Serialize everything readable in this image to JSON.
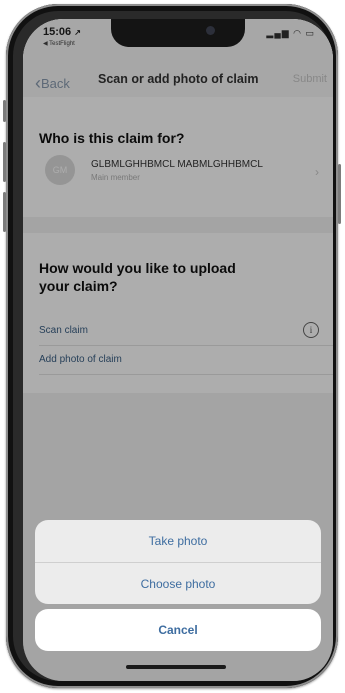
{
  "status_bar": {
    "time": "15:06",
    "time_arrow": "↗",
    "testflight": "◀ TestFlight",
    "icons": "▂▄▆ ◠ ▭"
  },
  "nav": {
    "back_chevron": "‹",
    "back_label": "Back",
    "title": "Scan or add photo of claim",
    "right_label": "Submit"
  },
  "claimant_section": {
    "title": "Who is this claim for?",
    "avatar_initials": "GM",
    "member_name": "GLBMLGHHBMCL MABMLGHHBMCL",
    "member_role": "Main member",
    "chevron": "›"
  },
  "upload_section": {
    "title": "How would you like to upload your claim?",
    "options": [
      {
        "label": "Scan claim"
      },
      {
        "label": "Add photo of claim"
      }
    ],
    "info_icon": "i"
  },
  "action_sheet": {
    "take_photo": "Take photo",
    "choose_photo": "Choose photo",
    "cancel": "Cancel"
  }
}
